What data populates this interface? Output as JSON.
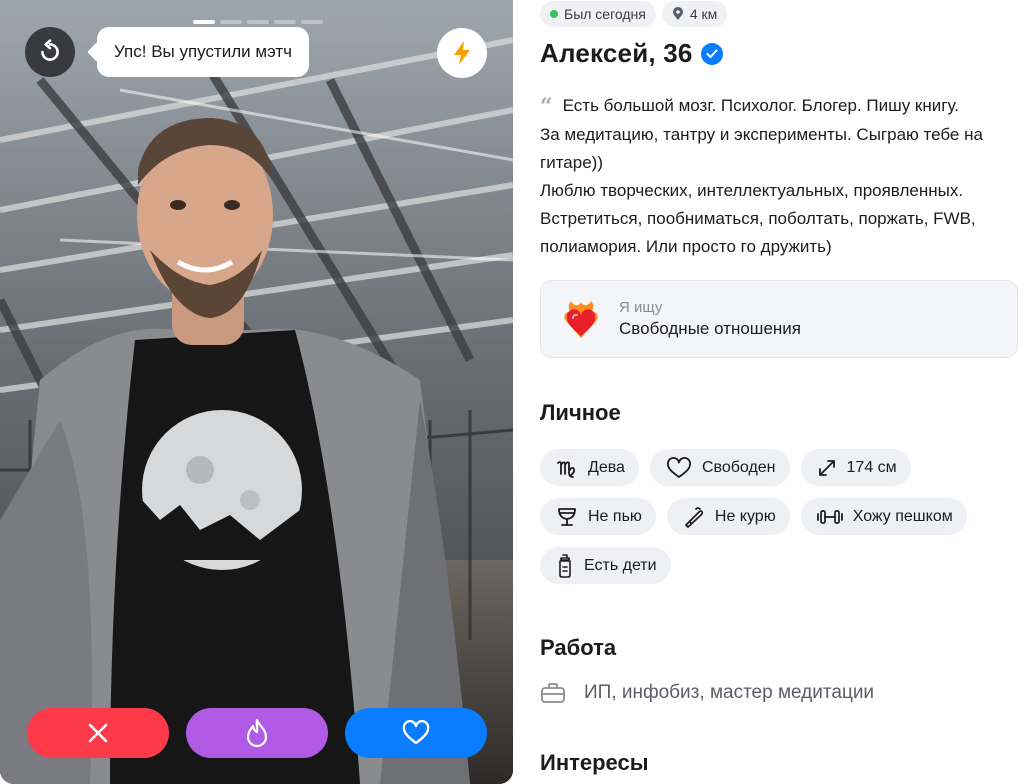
{
  "photo": {
    "alt": "",
    "progress_total": 6,
    "progress_active": 1
  },
  "toast": {
    "text": "Упс! Вы упустили мэтч"
  },
  "actions": {
    "undo_icon": "undo-icon",
    "boost_icon": "lightning-icon",
    "dislike_icon": "close-icon",
    "superlike_icon": "flame-icon",
    "like_icon": "heart-icon"
  },
  "colors": {
    "dislike": "#fd3a4a",
    "superlike": "#b05ae6",
    "like": "#0a7cff",
    "boost": "#f5a300",
    "online": "#33c25b",
    "verified": "#0a7cff"
  },
  "profile": {
    "last_seen": "Был сегодня",
    "distance": "4 км",
    "name": "Алексей, 36",
    "bio_lines": [
      "Есть большой мозг. Психолог. Блогер. Пишу книгу.",
      "За медитацию, тантру и эксперименты. Сыграю тебе на",
      "гитаре))",
      "Люблю творческих, интеллектуальных, проявленных.",
      "Встретиться, пообниматься, поболтать, поржать, FWB,",
      "полиамория. Или просто го дружить)"
    ],
    "looking": {
      "label": "Я ищу",
      "value": "Свободные отношения",
      "icon": "burning-heart-icon"
    },
    "personal_title": "Личное",
    "personal_chips": [
      {
        "icon": "virgo-icon",
        "label": "Дева"
      },
      {
        "icon": "heart-outline-icon",
        "label": "Свободен"
      },
      {
        "icon": "height-icon",
        "label": "174 см"
      },
      {
        "icon": "glass-icon",
        "label": "Не пью"
      },
      {
        "icon": "no-smoking-icon",
        "label": "Не курю"
      },
      {
        "icon": "dumbbell-icon",
        "label": "Хожу пешком"
      },
      {
        "icon": "baby-bottle-icon",
        "label": "Есть дети"
      }
    ],
    "work_title": "Работа",
    "work": {
      "icon": "briefcase-icon",
      "text": "ИП, инфобиз, мастер медитации"
    },
    "interests_title": "Интересы"
  }
}
